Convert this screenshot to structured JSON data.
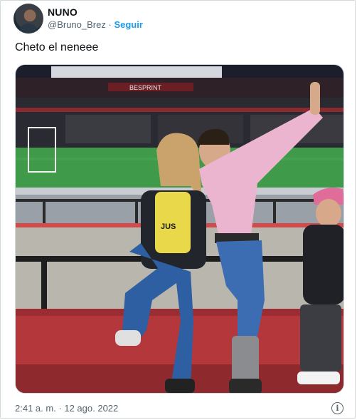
{
  "author": {
    "display_name": "NUNO",
    "handle": "@Bruno_Brez",
    "separator": "·",
    "follow_label": "Seguir",
    "avatar_icon": "profile-avatar"
  },
  "tweet": {
    "text": "Cheto el neneee",
    "timestamp": "2:41 a. m. · 12 ago. 2022",
    "info_icon_glyph": "i"
  },
  "media": {
    "banner_text": "BESPRINT",
    "shirt_text": "JUS",
    "description_icon": "photo"
  },
  "colors": {
    "link": "#1d9bf0",
    "secondary_text": "#536471",
    "border": "#cfd9de"
  }
}
